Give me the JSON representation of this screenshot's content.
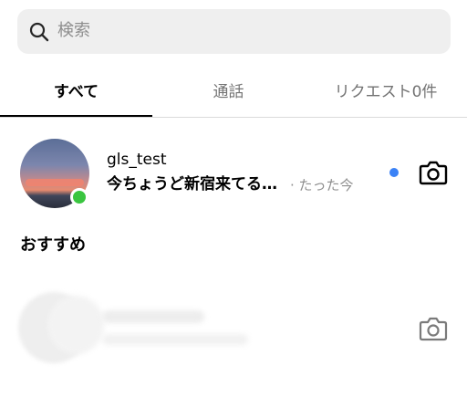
{
  "search": {
    "placeholder": "検索"
  },
  "tabs": [
    {
      "label": "すべて",
      "active": true
    },
    {
      "label": "通話",
      "active": false
    },
    {
      "label": "リクエスト0件",
      "active": false
    }
  ],
  "thread": {
    "username": "gls_test",
    "message": "今ちょうど新宿来てる…",
    "time": "· たった今",
    "online": true,
    "unread": true
  },
  "suggestions": {
    "heading": "おすすめ"
  },
  "colors": {
    "online": "#3ac540",
    "unread": "#3b82f6",
    "search_background": "#efefef",
    "secondary_text": "#8e8e8e"
  },
  "icons": {
    "search": "search-icon",
    "camera": "camera-icon"
  }
}
